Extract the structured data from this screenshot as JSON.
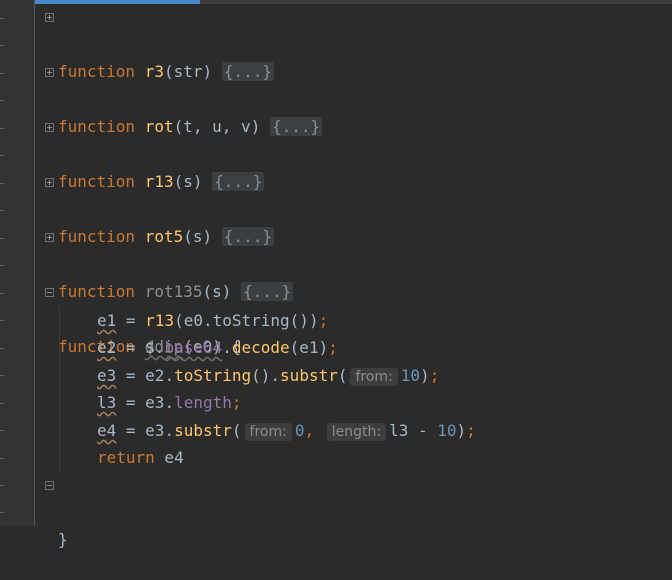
{
  "functions": [
    {
      "keyword": "function",
      "name": "r3",
      "open": "(",
      "params": "str",
      "close": ")",
      "folded": "{...}"
    },
    {
      "keyword": "function",
      "name": "rot",
      "open": "(",
      "params": "t, u, v",
      "close": ")",
      "folded": "{...}"
    },
    {
      "keyword": "function",
      "name": "r13",
      "open": "(",
      "params": "s",
      "close": ")",
      "folded": "{...}"
    },
    {
      "keyword": "function",
      "name": "rot5",
      "open": "(",
      "params": "s",
      "close": ")",
      "folded": "{...}"
    },
    {
      "keyword": "function",
      "name": "rot135",
      "open": "(",
      "params": "s",
      "close": ")",
      "folded": "{...}"
    }
  ],
  "ddip": {
    "keyword": "function",
    "name": "ddip",
    "signature_rest": "(e0) {",
    "line1": {
      "var": "e1",
      "eq": " = ",
      "call": "r13",
      "rest": "(e0.toString())",
      "semi": ";"
    },
    "line2": {
      "var": "e2",
      "eq": " = ",
      "obj": "$.",
      "prop": "base64",
      "dot": ".",
      "call": "decode",
      "rest": "(e1)",
      "semi": ";"
    },
    "line3": {
      "var": "e3",
      "eq": " = ",
      "obj": "e2.",
      "call1": "toString",
      "mid": "().",
      "call2": "substr",
      "open": "(",
      "hint": "from:",
      "num": "10",
      "close": ")",
      "semi": ";"
    },
    "line4": {
      "var": "l3",
      "eq": " = ",
      "obj": "e3.",
      "prop": "length",
      "semi": ";"
    },
    "line5": {
      "var": "e4",
      "eq": " = ",
      "obj": "e3.",
      "call": "substr",
      "open": "(",
      "hint1": "from:",
      "num1": "0",
      "comma": ",",
      "hint2": "length:",
      "expr": "l3 - ",
      "num2": "10",
      "close": ")",
      "semi": ";"
    },
    "line6": {
      "keyword": "return",
      "value": " e4"
    },
    "closing": "}"
  }
}
